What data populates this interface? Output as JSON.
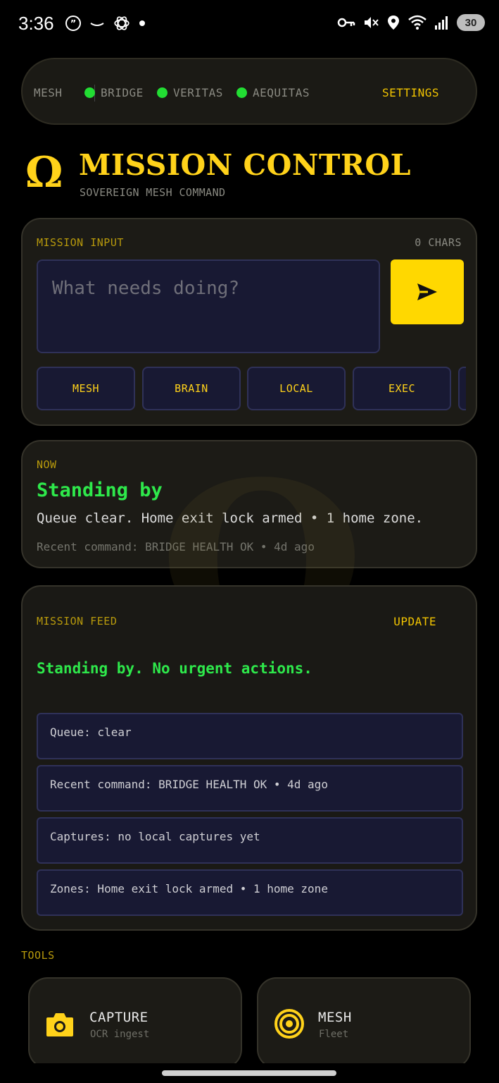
{
  "status_bar": {
    "time": "3:36",
    "battery": "30",
    "left_icons": [
      "quote-icon",
      "amazon-smile-icon",
      "chatgpt-icon",
      "dot-icon"
    ],
    "right_icons": [
      "vpn-key-icon",
      "mute-icon",
      "location-icon",
      "wifi-icon",
      "signal-icon"
    ]
  },
  "top_nav": {
    "mesh": "MESH",
    "nodes": [
      {
        "label": "BRIDGE",
        "status_color": "#22dd33"
      },
      {
        "label": "VERITAS",
        "status_color": "#22dd33"
      },
      {
        "label": "AEQUITAS",
        "status_color": "#22dd33"
      }
    ],
    "settings": "SETTINGS"
  },
  "header": {
    "logo": "Ω",
    "title": "MISSION CONTROL",
    "subtitle": "SOVEREIGN MESH COMMAND"
  },
  "mission_input": {
    "label": "MISSION INPUT",
    "char_count": "0 CHARS",
    "placeholder": "What needs doing?",
    "modes": [
      "MESH",
      "BRAIN",
      "LOCAL",
      "EXEC"
    ]
  },
  "now": {
    "label": "NOW",
    "title": "Standing by",
    "description": "Queue clear. Home exit lock armed • 1 home zone.",
    "recent": "Recent command: BRIDGE HEALTH OK • 4d ago"
  },
  "feed": {
    "label": "MISSION FEED",
    "update": "UPDATE",
    "headline": "Standing by. No urgent actions.",
    "items": [
      "Queue: clear",
      "Recent command: BRIDGE HEALTH OK • 4d ago",
      "Captures: no local captures yet",
      "Zones: Home exit lock armed • 1 home zone"
    ]
  },
  "tools": {
    "label": "TOOLS",
    "items": [
      {
        "name": "CAPTURE",
        "sub": "OCR ingest",
        "icon": "camera-icon"
      },
      {
        "name": "MESH",
        "sub": "Fleet",
        "icon": "target-icon"
      }
    ]
  },
  "colors": {
    "accent": "#ffd21a",
    "ok_green": "#2ee84b",
    "input_bg": "#181933"
  }
}
